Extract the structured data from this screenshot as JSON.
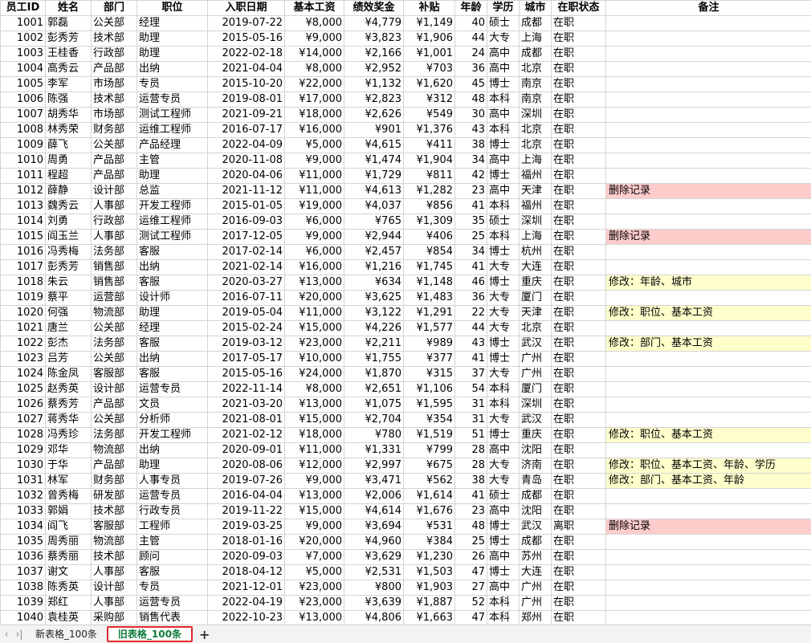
{
  "headers": [
    "员工ID",
    "姓名",
    "部门",
    "职位",
    "入职日期",
    "基本工资",
    "绩效奖金",
    "补贴",
    "年龄",
    "学历",
    "城市",
    "在职状态",
    "备注"
  ],
  "rows": [
    [
      "1001",
      "郭磊",
      "公关部",
      "经理",
      "2019-07-22",
      "¥8,000",
      "¥4,779",
      "¥1,149",
      "40",
      "硕士",
      "成都",
      "在职",
      ""
    ],
    [
      "1002",
      "彭秀芳",
      "技术部",
      "助理",
      "2015-05-16",
      "¥9,000",
      "¥3,823",
      "¥1,906",
      "44",
      "大专",
      "上海",
      "在职",
      ""
    ],
    [
      "1003",
      "王桂香",
      "行政部",
      "助理",
      "2022-02-18",
      "¥14,000",
      "¥2,166",
      "¥1,001",
      "24",
      "高中",
      "成都",
      "在职",
      ""
    ],
    [
      "1004",
      "高秀云",
      "产品部",
      "出纳",
      "2021-04-04",
      "¥8,000",
      "¥2,952",
      "¥703",
      "36",
      "高中",
      "北京",
      "在职",
      ""
    ],
    [
      "1005",
      "李军",
      "市场部",
      "专员",
      "2015-10-20",
      "¥22,000",
      "¥1,132",
      "¥1,620",
      "45",
      "博士",
      "南京",
      "在职",
      ""
    ],
    [
      "1006",
      "陈强",
      "技术部",
      "运营专员",
      "2019-08-01",
      "¥17,000",
      "¥2,823",
      "¥312",
      "48",
      "本科",
      "南京",
      "在职",
      ""
    ],
    [
      "1007",
      "胡秀华",
      "市场部",
      "测试工程师",
      "2021-09-21",
      "¥18,000",
      "¥2,626",
      "¥549",
      "30",
      "高中",
      "深圳",
      "在职",
      ""
    ],
    [
      "1008",
      "林秀荣",
      "财务部",
      "运维工程师",
      "2016-07-17",
      "¥16,000",
      "¥901",
      "¥1,376",
      "43",
      "本科",
      "北京",
      "在职",
      ""
    ],
    [
      "1009",
      "薛飞",
      "公关部",
      "产品经理",
      "2022-04-09",
      "¥5,000",
      "¥4,615",
      "¥411",
      "38",
      "博士",
      "北京",
      "在职",
      ""
    ],
    [
      "1010",
      "周勇",
      "产品部",
      "主管",
      "2020-11-08",
      "¥9,000",
      "¥1,474",
      "¥1,904",
      "34",
      "高中",
      "上海",
      "在职",
      ""
    ],
    [
      "1011",
      "程超",
      "产品部",
      "助理",
      "2020-04-06",
      "¥11,000",
      "¥1,729",
      "¥811",
      "42",
      "博士",
      "福州",
      "在职",
      ""
    ],
    [
      "1012",
      "薛静",
      "设计部",
      "总监",
      "2021-11-12",
      "¥11,000",
      "¥4,613",
      "¥1,282",
      "23",
      "高中",
      "天津",
      "在职",
      "删除记录"
    ],
    [
      "1013",
      "魏秀云",
      "人事部",
      "开发工程师",
      "2015-01-05",
      "¥19,000",
      "¥4,037",
      "¥856",
      "41",
      "本科",
      "福州",
      "在职",
      ""
    ],
    [
      "1014",
      "刘勇",
      "行政部",
      "运维工程师",
      "2016-09-03",
      "¥6,000",
      "¥765",
      "¥1,309",
      "35",
      "硕士",
      "深圳",
      "在职",
      ""
    ],
    [
      "1015",
      "阎玉兰",
      "人事部",
      "测试工程师",
      "2017-12-05",
      "¥9,000",
      "¥2,944",
      "¥406",
      "25",
      "本科",
      "上海",
      "在职",
      "删除记录"
    ],
    [
      "1016",
      "冯秀梅",
      "法务部",
      "客服",
      "2017-02-14",
      "¥6,000",
      "¥2,457",
      "¥854",
      "34",
      "博士",
      "杭州",
      "在职",
      ""
    ],
    [
      "1017",
      "彭秀芳",
      "销售部",
      "出纳",
      "2021-02-14",
      "¥16,000",
      "¥1,216",
      "¥1,745",
      "41",
      "大专",
      "大连",
      "在职",
      ""
    ],
    [
      "1018",
      "朱云",
      "销售部",
      "客服",
      "2020-03-27",
      "¥13,000",
      "¥634",
      "¥1,148",
      "46",
      "博士",
      "重庆",
      "在职",
      "修改：年龄、城市"
    ],
    [
      "1019",
      "蔡平",
      "运营部",
      "设计师",
      "2016-07-11",
      "¥20,000",
      "¥3,625",
      "¥1,483",
      "36",
      "大专",
      "厦门",
      "在职",
      ""
    ],
    [
      "1020",
      "何强",
      "物流部",
      "助理",
      "2019-05-04",
      "¥11,000",
      "¥3,122",
      "¥1,291",
      "22",
      "大专",
      "天津",
      "在职",
      "修改：职位、基本工资"
    ],
    [
      "1021",
      "唐兰",
      "公关部",
      "经理",
      "2015-02-24",
      "¥15,000",
      "¥4,226",
      "¥1,577",
      "44",
      "大专",
      "北京",
      "在职",
      ""
    ],
    [
      "1022",
      "彭杰",
      "法务部",
      "客服",
      "2019-03-12",
      "¥23,000",
      "¥2,211",
      "¥989",
      "43",
      "博士",
      "武汉",
      "在职",
      "修改：部门、基本工资"
    ],
    [
      "1023",
      "吕芳",
      "公关部",
      "出纳",
      "2017-05-17",
      "¥10,000",
      "¥1,755",
      "¥377",
      "41",
      "博士",
      "广州",
      "在职",
      ""
    ],
    [
      "1024",
      "陈金凤",
      "客服部",
      "客服",
      "2015-05-16",
      "¥24,000",
      "¥1,870",
      "¥315",
      "37",
      "大专",
      "广州",
      "在职",
      ""
    ],
    [
      "1025",
      "赵秀英",
      "设计部",
      "运营专员",
      "2022-11-14",
      "¥8,000",
      "¥2,651",
      "¥1,106",
      "54",
      "本科",
      "厦门",
      "在职",
      ""
    ],
    [
      "1026",
      "蔡秀芳",
      "产品部",
      "文员",
      "2021-03-20",
      "¥13,000",
      "¥1,075",
      "¥1,595",
      "31",
      "本科",
      "深圳",
      "在职",
      ""
    ],
    [
      "1027",
      "蒋秀华",
      "公关部",
      "分析师",
      "2021-08-01",
      "¥15,000",
      "¥2,704",
      "¥354",
      "31",
      "大专",
      "武汉",
      "在职",
      ""
    ],
    [
      "1028",
      "冯秀珍",
      "法务部",
      "开发工程师",
      "2021-02-12",
      "¥18,000",
      "¥780",
      "¥1,519",
      "51",
      "博士",
      "重庆",
      "在职",
      "修改：职位、基本工资"
    ],
    [
      "1029",
      "邓华",
      "物流部",
      "出纳",
      "2020-09-01",
      "¥11,000",
      "¥1,331",
      "¥799",
      "28",
      "高中",
      "沈阳",
      "在职",
      ""
    ],
    [
      "1030",
      "于华",
      "产品部",
      "助理",
      "2020-08-06",
      "¥12,000",
      "¥2,997",
      "¥675",
      "28",
      "大专",
      "济南",
      "在职",
      "修改：职位、基本工资、年龄、学历"
    ],
    [
      "1031",
      "林军",
      "财务部",
      "人事专员",
      "2019-07-26",
      "¥9,000",
      "¥3,471",
      "¥562",
      "38",
      "大专",
      "青岛",
      "在职",
      "修改：部门、基本工资、年龄"
    ],
    [
      "1032",
      "曾秀梅",
      "研发部",
      "运营专员",
      "2016-04-04",
      "¥13,000",
      "¥2,006",
      "¥1,614",
      "41",
      "硕士",
      "成都",
      "在职",
      ""
    ],
    [
      "1033",
      "郭娟",
      "技术部",
      "行政专员",
      "2019-11-22",
      "¥15,000",
      "¥4,614",
      "¥1,676",
      "23",
      "高中",
      "沈阳",
      "在职",
      ""
    ],
    [
      "1034",
      "阎飞",
      "客服部",
      "工程师",
      "2019-03-25",
      "¥9,000",
      "¥3,694",
      "¥531",
      "48",
      "博士",
      "武汉",
      "离职",
      "删除记录"
    ],
    [
      "1035",
      "周秀丽",
      "物流部",
      "主管",
      "2018-01-16",
      "¥20,000",
      "¥4,960",
      "¥384",
      "25",
      "博士",
      "成都",
      "在职",
      ""
    ],
    [
      "1036",
      "蔡秀丽",
      "技术部",
      "顾问",
      "2020-09-03",
      "¥7,000",
      "¥3,629",
      "¥1,230",
      "26",
      "高中",
      "苏州",
      "在职",
      ""
    ],
    [
      "1037",
      "谢文",
      "人事部",
      "客服",
      "2018-04-12",
      "¥5,000",
      "¥2,531",
      "¥1,503",
      "47",
      "博士",
      "大连",
      "在职",
      ""
    ],
    [
      "1038",
      "陈秀英",
      "设计部",
      "专员",
      "2021-12-01",
      "¥23,000",
      "¥800",
      "¥1,903",
      "27",
      "高中",
      "广州",
      "在职",
      ""
    ],
    [
      "1039",
      "郑红",
      "人事部",
      "运营专员",
      "2022-04-19",
      "¥23,000",
      "¥3,639",
      "¥1,887",
      "52",
      "本科",
      "广州",
      "在职",
      ""
    ],
    [
      "1040",
      "袁桂英",
      "采购部",
      "销售代表",
      "2022-10-23",
      "¥13,000",
      "¥4,806",
      "¥1,663",
      "47",
      "本科",
      "郑州",
      "在职",
      ""
    ]
  ],
  "tabs": {
    "nav_first": "‹",
    "nav_last": "›|",
    "sheet1": "新表格_100条",
    "sheet2": "旧表格_100条",
    "add": "+"
  },
  "colors": {
    "delete_highlight": "#ffcccc",
    "modify_highlight": "#ffffcc",
    "active_tab_text": "#0f7b3b",
    "active_tab_border": "#e0292b"
  }
}
